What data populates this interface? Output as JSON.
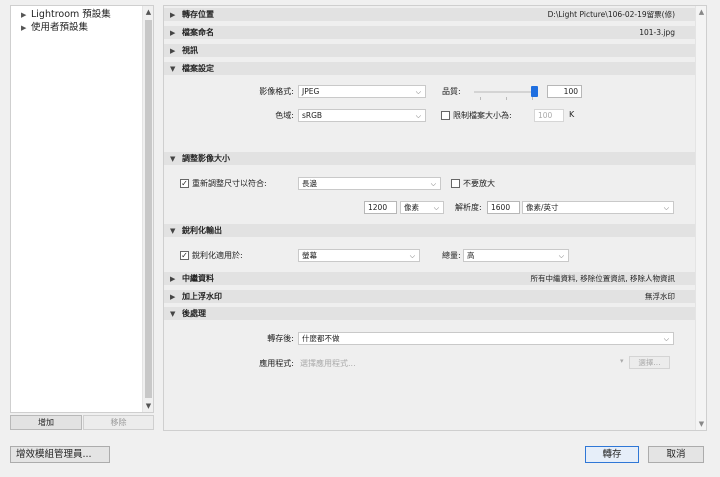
{
  "presets": {
    "items": [
      {
        "label": "Lightroom 預設集"
      },
      {
        "label": "使用者預設集"
      }
    ],
    "add_label": "增加",
    "remove_label": "移除"
  },
  "sections": {
    "export_location": {
      "title": "轉存位置",
      "summary": "D:\\Light Picture\\106-02-19留票(修)"
    },
    "file_naming": {
      "title": "檔案命名",
      "summary": "101-3.jpg"
    },
    "video": {
      "title": "視訊"
    },
    "file_settings": {
      "title": "檔案設定",
      "format_label": "影像格式:",
      "format_value": "JPEG",
      "quality_label": "品質:",
      "quality_value": "100",
      "quality_fraction": 1.0,
      "colorspace_label": "色域:",
      "colorspace_value": "sRGB",
      "limit_size_label": "限制檔案大小為:",
      "limit_size_checked": false,
      "limit_size_value": "100",
      "limit_size_unit": "K"
    },
    "image_sizing": {
      "title": "調整影像大小",
      "resize_label": "重新調整尺寸以符合:",
      "resize_checked": true,
      "resize_value": "長邊",
      "no_enlarge_label": "不要放大",
      "no_enlarge_checked": false,
      "size_value": "1200",
      "size_unit": "像素",
      "resolution_label": "解析度:",
      "resolution_value": "1600",
      "resolution_unit": "像素/英寸"
    },
    "output_sharpening": {
      "title": "銳利化輸出",
      "sharpen_label": "銳利化適用於:",
      "sharpen_checked": true,
      "sharpen_value": "螢幕",
      "amount_label": "總量:",
      "amount_value": "高"
    },
    "metadata": {
      "title": "中繼資料",
      "summary": "所有中繼資料, 移除位置資訊, 移除人物資訊"
    },
    "watermark": {
      "title": "加上浮水印",
      "summary": "無浮水印"
    },
    "post_processing": {
      "title": "後處理",
      "after_export_label": "轉存後:",
      "after_export_value": "什麼都不做",
      "application_label": "應用程式:",
      "application_placeholder": "選擇應用程式...",
      "choose_label": "選擇..."
    }
  },
  "buttons": {
    "plugin_manager": "增效模組管理員...",
    "export": "轉存",
    "cancel": "取消"
  },
  "colors": {
    "accent": "#1f6fe0",
    "header_bg": "#e2e2e2",
    "panel_bg": "#efefef"
  }
}
